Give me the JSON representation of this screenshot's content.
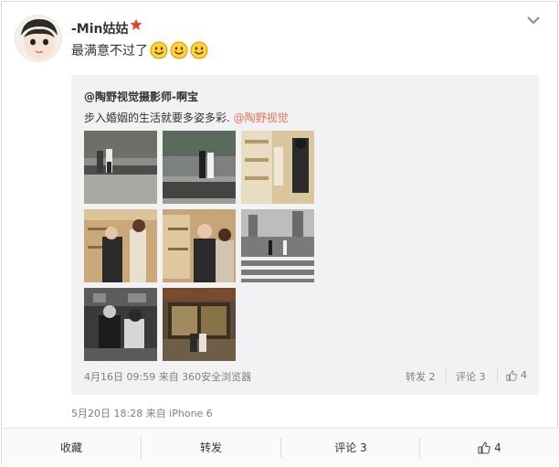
{
  "post": {
    "username": "-Min姑姑",
    "text": "最满意不过了",
    "emoji_count": 3,
    "meta": "5月20日 18:28 来自 iPhone 6"
  },
  "repost": {
    "author": "@陶野视觉摄影师-啊宝",
    "text": "步入婚姻的生活就要多姿多彩.",
    "mention": "@陶野视觉",
    "meta": "4月16日 09:59 来自 360安全浏览器",
    "actions": {
      "forward": "转发 2",
      "comment": "评论 3",
      "like": "4"
    }
  },
  "action_bar": {
    "favorite": "收藏",
    "forward": "转发",
    "comment": "评论 3",
    "like": "4"
  },
  "colors": {
    "accent": "#eb7350",
    "repost_bg": "#f2f2f5",
    "meta_text": "#808080",
    "vip_star": "#e8412c",
    "emoji_face": "#ffd23c"
  },
  "icons": {
    "vip": "vip-star-icon",
    "more": "chevron-down-icon",
    "like": "thumbs-up-icon",
    "emoji": "smiley-emoji-icon"
  }
}
